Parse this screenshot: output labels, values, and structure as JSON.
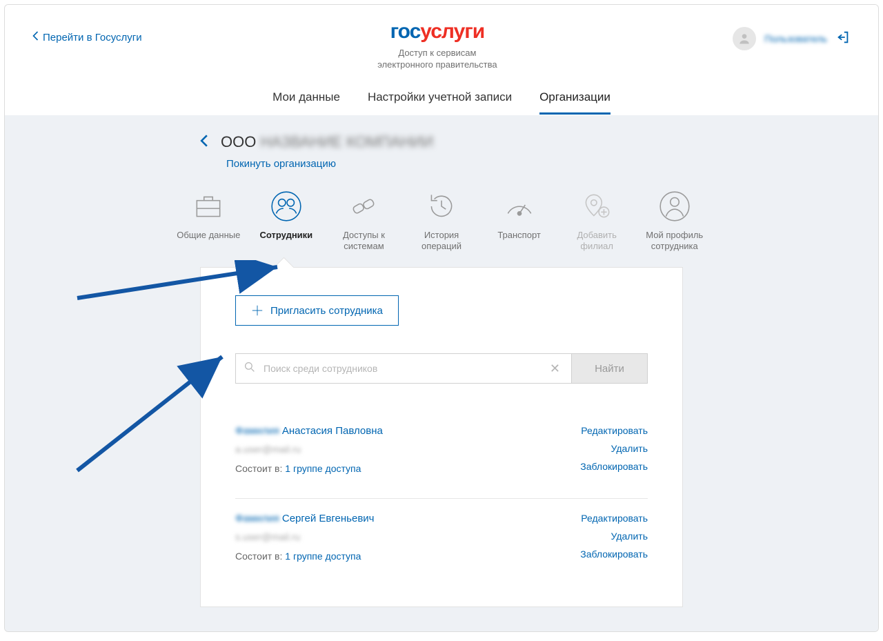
{
  "header": {
    "back_link": "Перейти в Госуслуги",
    "logo_part1": "гос",
    "logo_part2": "услуги",
    "subtitle_line1": "Доступ к сервисам",
    "subtitle_line2": "электронного правительства",
    "user_name": "Пользователь"
  },
  "nav": {
    "items": [
      {
        "label": "Мои данные",
        "active": false
      },
      {
        "label": "Настройки учетной записи",
        "active": false
      },
      {
        "label": "Организации",
        "active": true
      }
    ]
  },
  "org": {
    "prefix": "ООО",
    "name_blurred": "НАЗВАНИЕ КОМПАНИИ",
    "leave_label": "Покинуть организацию"
  },
  "tabs": [
    {
      "label": "Общие данные",
      "key": "general"
    },
    {
      "label": "Сотрудники",
      "key": "employees",
      "active": true
    },
    {
      "label": "Доступы к системам",
      "key": "access"
    },
    {
      "label": "История операций",
      "key": "history"
    },
    {
      "label": "Транспорт",
      "key": "transport"
    },
    {
      "label": "Добавить филиал",
      "key": "branch",
      "disabled": true
    },
    {
      "label": "Мой профиль сотрудника",
      "key": "profile"
    }
  ],
  "panel": {
    "invite_label": "Пригласить сотрудника",
    "search_placeholder": "Поиск среди сотрудников",
    "find_label": "Найти"
  },
  "employees": [
    {
      "surname_blurred": "Фамилия",
      "rest_name": "Анастасия Павловна",
      "email_blurred": "a.user@mail.ru",
      "groups_prefix": "Состоит в:",
      "groups_link": "1 группе доступа",
      "actions": {
        "edit": "Редактировать",
        "delete": "Удалить",
        "block": "Заблокировать"
      }
    },
    {
      "surname_blurred": "Фамилия",
      "rest_name": "Сергей Евгеньевич",
      "email_blurred": "s.user@mail.ru",
      "groups_prefix": "Состоит в:",
      "groups_link": "1 группе доступа",
      "actions": {
        "edit": "Редактировать",
        "delete": "Удалить",
        "block": "Заблокировать"
      }
    }
  ]
}
